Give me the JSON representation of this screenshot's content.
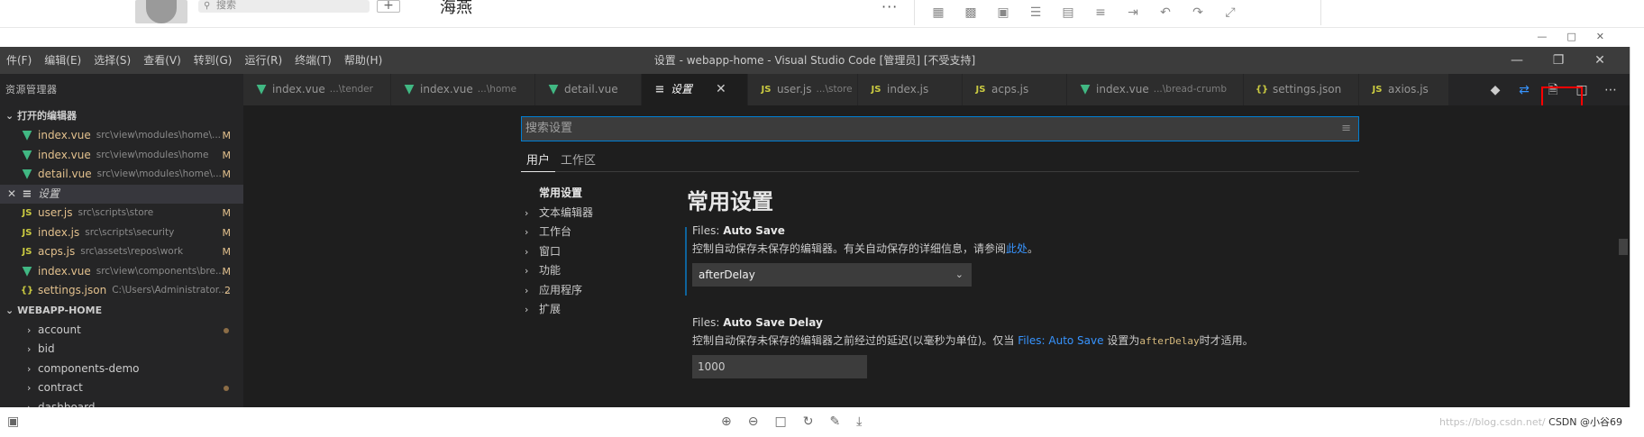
{
  "host": {
    "search_placeholder": "搜索",
    "plus": "+",
    "contact_name": "海燕",
    "more": "···",
    "tools": [
      "table-icon",
      "chart-icon",
      "image-icon",
      "list-icon",
      "film-icon",
      "align-icon",
      "indent-icon",
      "undo-icon",
      "redo-icon",
      "expand-icon"
    ],
    "bottom_tools": [
      "zoom-in-icon",
      "zoom-out-icon",
      "fit-icon",
      "rotate-icon",
      "edit-icon",
      "download-icon"
    ],
    "watermark_faint": "https://blog.csdn.net/",
    "watermark": "CSDN @小谷69"
  },
  "window": {
    "title": "设置 - webapp-home - Visual Studio Code [管理员] [不受支持]",
    "menu": [
      "件(F)",
      "编辑(E)",
      "选择(S)",
      "查看(V)",
      "转到(G)",
      "运行(R)",
      "终端(T)",
      "帮助(H)"
    ],
    "controls": {
      "minimize": "—",
      "maximize": "❐",
      "close": "✕"
    }
  },
  "sidebar": {
    "title": "资源管理器",
    "open_editors_label": "打开的编辑器",
    "open_editors": [
      {
        "icon": "vue",
        "name": "index.vue",
        "path": "src\\view\\modules\\home\\...",
        "badge": "M"
      },
      {
        "icon": "vue",
        "name": "index.vue",
        "path": "src\\view\\modules\\home",
        "badge": "M"
      },
      {
        "icon": "vue",
        "name": "detail.vue",
        "path": "src\\view\\modules\\home\\...",
        "badge": "M"
      },
      {
        "icon": "settings",
        "name": "设置",
        "path": "",
        "badge": "",
        "active": true
      },
      {
        "icon": "js",
        "name": "user.js",
        "path": "src\\scripts\\store",
        "badge": "M"
      },
      {
        "icon": "js",
        "name": "index.js",
        "path": "src\\scripts\\security",
        "badge": "M"
      },
      {
        "icon": "js",
        "name": "acps.js",
        "path": "src\\assets\\repos\\work",
        "badge": "M"
      },
      {
        "icon": "vue",
        "name": "index.vue",
        "path": "src\\view\\components\\bre...",
        "badge": "M"
      },
      {
        "icon": "json",
        "name": "settings.json",
        "path": "C:\\Users\\Administrator....",
        "badge": "2"
      }
    ],
    "workspace_label": "WEBAPP-HOME",
    "folders": [
      {
        "name": "account",
        "dot": true
      },
      {
        "name": "bid",
        "dot": false
      },
      {
        "name": "components-demo",
        "dot": false
      },
      {
        "name": "contract",
        "dot": true
      },
      {
        "name": "dashboard",
        "dot": false
      }
    ]
  },
  "tabs": [
    {
      "icon": "vue",
      "label": "index.vue",
      "desc": "...\\tender"
    },
    {
      "icon": "vue",
      "label": "index.vue",
      "desc": "...\\home"
    },
    {
      "icon": "vue",
      "label": "detail.vue",
      "desc": ""
    },
    {
      "icon": "settings",
      "label": "设置",
      "desc": "",
      "active": true
    },
    {
      "icon": "js",
      "label": "user.js",
      "desc": "...\\store"
    },
    {
      "icon": "js",
      "label": "index.js",
      "desc": ""
    },
    {
      "icon": "js",
      "label": "acps.js",
      "desc": ""
    },
    {
      "icon": "vue",
      "label": "index.vue",
      "desc": "...\\bread-crumb"
    },
    {
      "icon": "json",
      "label": "settings.json",
      "desc": ""
    },
    {
      "icon": "js",
      "label": "axios.js",
      "desc": ""
    }
  ],
  "tab_actions": [
    "git-compare-icon",
    "sync-icon",
    "open-settings-json-icon",
    "split-editor-icon",
    "more-actions-icon"
  ],
  "settings": {
    "search_placeholder": "搜索设置",
    "scopes": [
      "用户",
      "工作区"
    ],
    "toc": [
      {
        "label": "常用设置",
        "expandable": false,
        "selected": true
      },
      {
        "label": "文本编辑器",
        "expandable": true
      },
      {
        "label": "工作台",
        "expandable": true
      },
      {
        "label": "窗口",
        "expandable": true
      },
      {
        "label": "功能",
        "expandable": true
      },
      {
        "label": "应用程序",
        "expandable": true
      },
      {
        "label": "扩展",
        "expandable": true
      }
    ],
    "section_title": "常用设置",
    "auto_save": {
      "category": "Files: ",
      "key": "Auto Save",
      "desc_before": "控制自动保存未保存的编辑器。有关自动保存的详细信息，请参阅",
      "desc_link": "此处",
      "desc_after": "。",
      "value": "afterDelay"
    },
    "auto_save_delay": {
      "category": "Files: ",
      "key": "Auto Save Delay",
      "desc_before": "控制自动保存未保存的编辑器之前经过的延迟(以毫秒为单位)。仅当 ",
      "desc_link": "Files: Auto Save",
      "desc_mid": " 设置为",
      "desc_code": "afterDelay",
      "desc_after": "时才适用。",
      "value": "1000"
    }
  }
}
